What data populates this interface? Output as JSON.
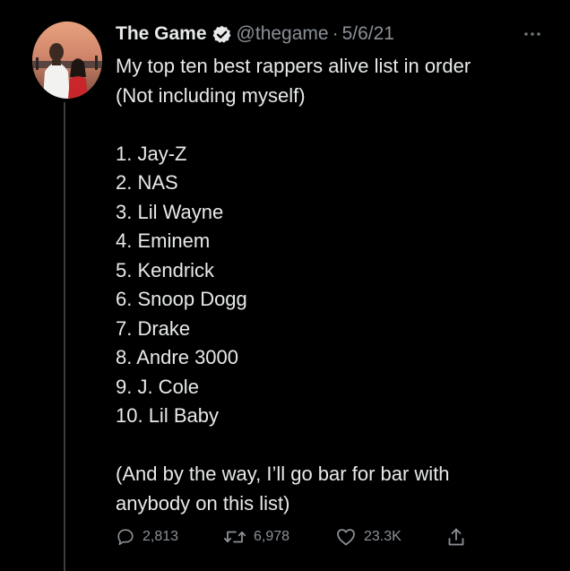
{
  "author": {
    "display_name": "The Game",
    "handle": "@thegame",
    "separator": "·",
    "date": "5/6/21"
  },
  "tweet": {
    "lines": [
      "My top ten best rappers alive list in order",
      "(Not including myself)",
      "",
      "1. Jay-Z",
      "2. NAS",
      "3. Lil Wayne",
      "4. Eminem",
      "5. Kendrick",
      "6. Snoop Dogg",
      "7. Drake",
      "8. Andre 3000",
      "9. J. Cole",
      "10. Lil Baby",
      "",
      "(And by the way, I’ll go bar for bar with",
      "anybody on this list)"
    ]
  },
  "stats": {
    "replies": "2,813",
    "retweets": "6,978",
    "likes": "23.3K"
  },
  "colors": {
    "background": "#000000",
    "text": "#e7e9ea",
    "secondary": "#8b9096",
    "thread_line": "#3a3d40"
  },
  "icons": {
    "verified": "verified-badge-icon",
    "more": "more-options-icon",
    "reply": "reply-icon",
    "retweet": "retweet-icon",
    "like": "heart-icon",
    "share": "share-icon"
  }
}
